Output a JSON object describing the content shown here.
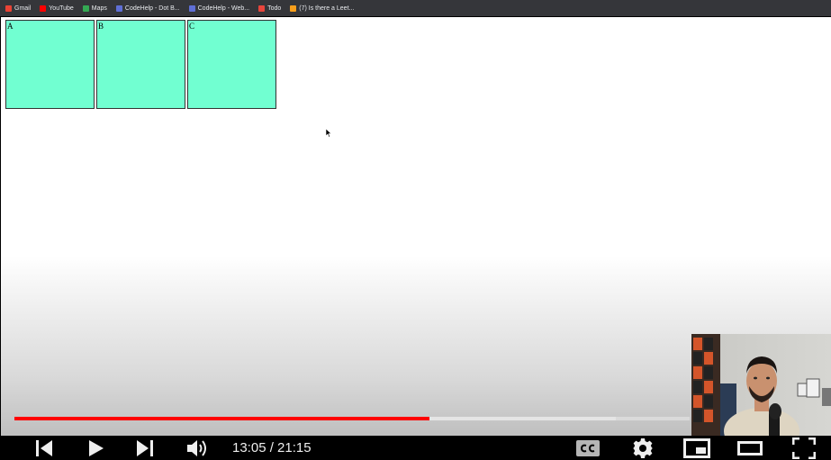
{
  "bookmarks": [
    {
      "label": "Gmail",
      "icon": "gmail-icon",
      "color": "#ea4335"
    },
    {
      "label": "YouTube",
      "icon": "youtube-icon",
      "color": "#ff0000"
    },
    {
      "label": "Maps",
      "icon": "maps-icon",
      "color": "#34a853"
    },
    {
      "label": "CodeHelp - Dot B...",
      "icon": "codehelp-icon",
      "color": "#5f6fd6"
    },
    {
      "label": "CodeHelp - Web...",
      "icon": "codehelp-icon",
      "color": "#5f6fd6"
    },
    {
      "label": "Todo",
      "icon": "todo-icon",
      "color": "#e8453c"
    },
    {
      "label": "(7) Is there a Leet...",
      "icon": "leetcode-icon",
      "color": "#f89f1b"
    }
  ],
  "page": {
    "boxes": [
      {
        "label": "A"
      },
      {
        "label": "B"
      },
      {
        "label": "C"
      }
    ],
    "box_color": "#71ffd1"
  },
  "player": {
    "current_time": "13:05",
    "duration": "21:15",
    "time_display": "13:05 / 21:15",
    "played_fraction": 0.615,
    "buffered_fraction": 0.89,
    "progress_color": "#ff0000",
    "buttons": [
      "previous-icon",
      "play-icon",
      "next-icon",
      "volume-icon",
      "cc-icon",
      "settings-icon",
      "miniplayer-icon",
      "theater-icon",
      "fullscreen-icon"
    ]
  }
}
